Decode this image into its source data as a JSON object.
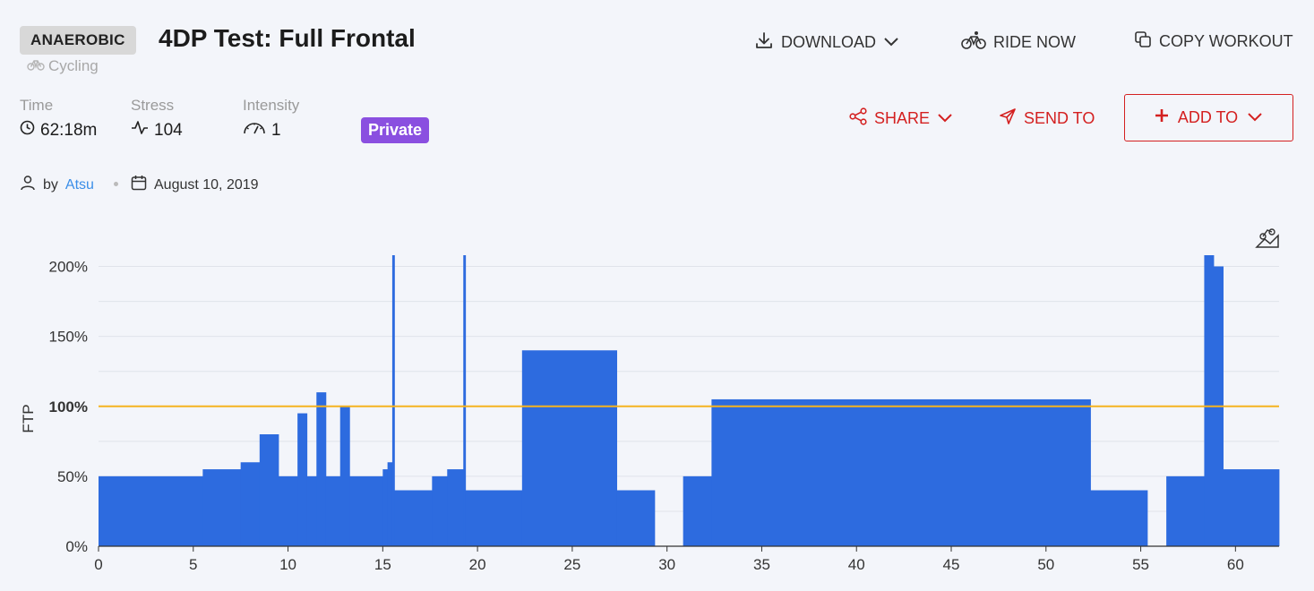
{
  "header": {
    "badge": "ANAEROBIC",
    "title": "4DP Test: Full Frontal",
    "sport": "Cycling"
  },
  "actions": {
    "download": "DOWNLOAD",
    "ride_now": "RIDE NOW",
    "copy_workout": "COPY WORKOUT",
    "share": "SHARE",
    "send_to": "SEND TO",
    "add_to": "ADD TO"
  },
  "stats": {
    "time_label": "Time",
    "time_value": "62:18m",
    "stress_label": "Stress",
    "stress_value": "104",
    "intensity_label": "Intensity",
    "intensity_value": "1",
    "visibility": "Private"
  },
  "meta": {
    "by_prefix": "by",
    "author": "Atsu",
    "date": "August 10, 2019"
  },
  "colors": {
    "bar": "#2d6bdf",
    "ftp_line": "#f5b31f",
    "accent_red": "#d42020",
    "private_badge": "#8a4fe0"
  },
  "icons": [
    "bike-icon",
    "download-icon",
    "chevron-down-icon",
    "copy-icon",
    "clock-icon",
    "pulse-icon",
    "gauge-icon",
    "share-icon",
    "send-icon",
    "plus-icon",
    "user-icon",
    "calendar-icon",
    "elevation-bike-icon"
  ],
  "chart_data": {
    "type": "bar",
    "ylabel": "FTP",
    "xlim": [
      0,
      62.3
    ],
    "ylim": [
      0,
      208
    ],
    "yticks": [
      0,
      50,
      100,
      150,
      200
    ],
    "ytick_labels": [
      "0%",
      "50%",
      "100%",
      "150%",
      "200%"
    ],
    "xticks": [
      0,
      5,
      10,
      15,
      20,
      25,
      30,
      35,
      40,
      45,
      50,
      55,
      60
    ],
    "xtick_labels": [
      "0",
      "5",
      "10",
      "15",
      "20",
      "25",
      "30",
      "35",
      "40",
      "45",
      "50",
      "55",
      "60"
    ],
    "reference_line": {
      "value": 100
    },
    "grid": true,
    "segments": [
      {
        "start": 0,
        "end": 5.5,
        "value": 50
      },
      {
        "start": 5.5,
        "end": 7.5,
        "value": 55
      },
      {
        "start": 7.5,
        "end": 8.5,
        "value": 60
      },
      {
        "start": 8.5,
        "end": 9.5,
        "value": 80
      },
      {
        "start": 9.5,
        "end": 10.5,
        "value": 50
      },
      {
        "start": 10.5,
        "end": 11.0,
        "value": 95
      },
      {
        "start": 11.0,
        "end": 11.5,
        "value": 50
      },
      {
        "start": 11.5,
        "end": 12.0,
        "value": 110
      },
      {
        "start": 12.0,
        "end": 12.75,
        "value": 50
      },
      {
        "start": 12.75,
        "end": 13.25,
        "value": 100
      },
      {
        "start": 13.25,
        "end": 15.0,
        "value": 50
      },
      {
        "start": 15.0,
        "end": 15.25,
        "value": 55
      },
      {
        "start": 15.25,
        "end": 15.5,
        "value": 60
      },
      {
        "start": 15.5,
        "end": 15.6,
        "value": 208
      },
      {
        "start": 15.6,
        "end": 17.6,
        "value": 40
      },
      {
        "start": 17.6,
        "end": 18.4,
        "value": 50
      },
      {
        "start": 18.4,
        "end": 19.25,
        "value": 55
      },
      {
        "start": 19.25,
        "end": 19.35,
        "value": 208
      },
      {
        "start": 19.35,
        "end": 22.35,
        "value": 40
      },
      {
        "start": 22.35,
        "end": 27.35,
        "value": 140
      },
      {
        "start": 27.35,
        "end": 29.35,
        "value": 40
      },
      {
        "start": 30.85,
        "end": 32.35,
        "value": 50
      },
      {
        "start": 32.35,
        "end": 52.35,
        "value": 105
      },
      {
        "start": 52.35,
        "end": 55.35,
        "value": 40
      },
      {
        "start": 56.35,
        "end": 58.35,
        "value": 50
      },
      {
        "start": 58.35,
        "end": 58.85,
        "value": 208
      },
      {
        "start": 58.85,
        "end": 59.35,
        "value": 200
      },
      {
        "start": 59.35,
        "end": 62.3,
        "value": 55
      }
    ]
  }
}
